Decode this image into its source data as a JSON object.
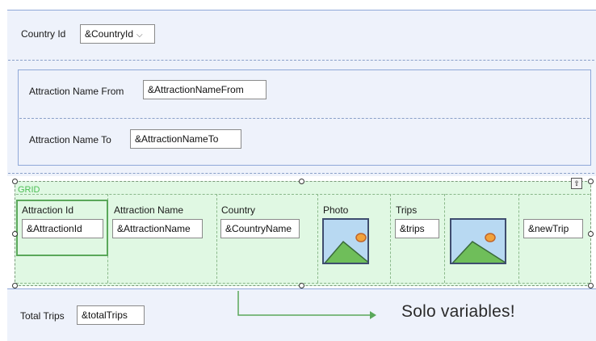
{
  "top": {
    "country_label": "Country Id",
    "country_value": "&CountryId"
  },
  "filters": {
    "from_label": "Attraction Name From",
    "from_value": "&AttractionNameFrom",
    "to_label": "Attraction Name To",
    "to_value": "&AttractionNameTo"
  },
  "grid": {
    "title": "GRID",
    "columns": [
      {
        "header": "Attraction Id",
        "value": "&AttractionId"
      },
      {
        "header": "Attraction Name",
        "value": "&AttractionName"
      },
      {
        "header": "Country",
        "value": "&CountryName"
      },
      {
        "header": "Photo",
        "value": ""
      },
      {
        "header": "Trips",
        "value": "&trips"
      },
      {
        "header": "",
        "value": ""
      },
      {
        "header": "",
        "value": "&newTrip"
      }
    ],
    "up_button": "⇧"
  },
  "footer": {
    "total_label": "Total Trips",
    "total_value": "&totalTrips"
  },
  "annotation": "Solo variables!",
  "colors": {
    "panel_bg": "#eef2fb",
    "grid_bg": "#e0f8e3",
    "grid_title": "#4cbf55",
    "selection": "#5aa85a",
    "arrow": "#5aa85a"
  }
}
